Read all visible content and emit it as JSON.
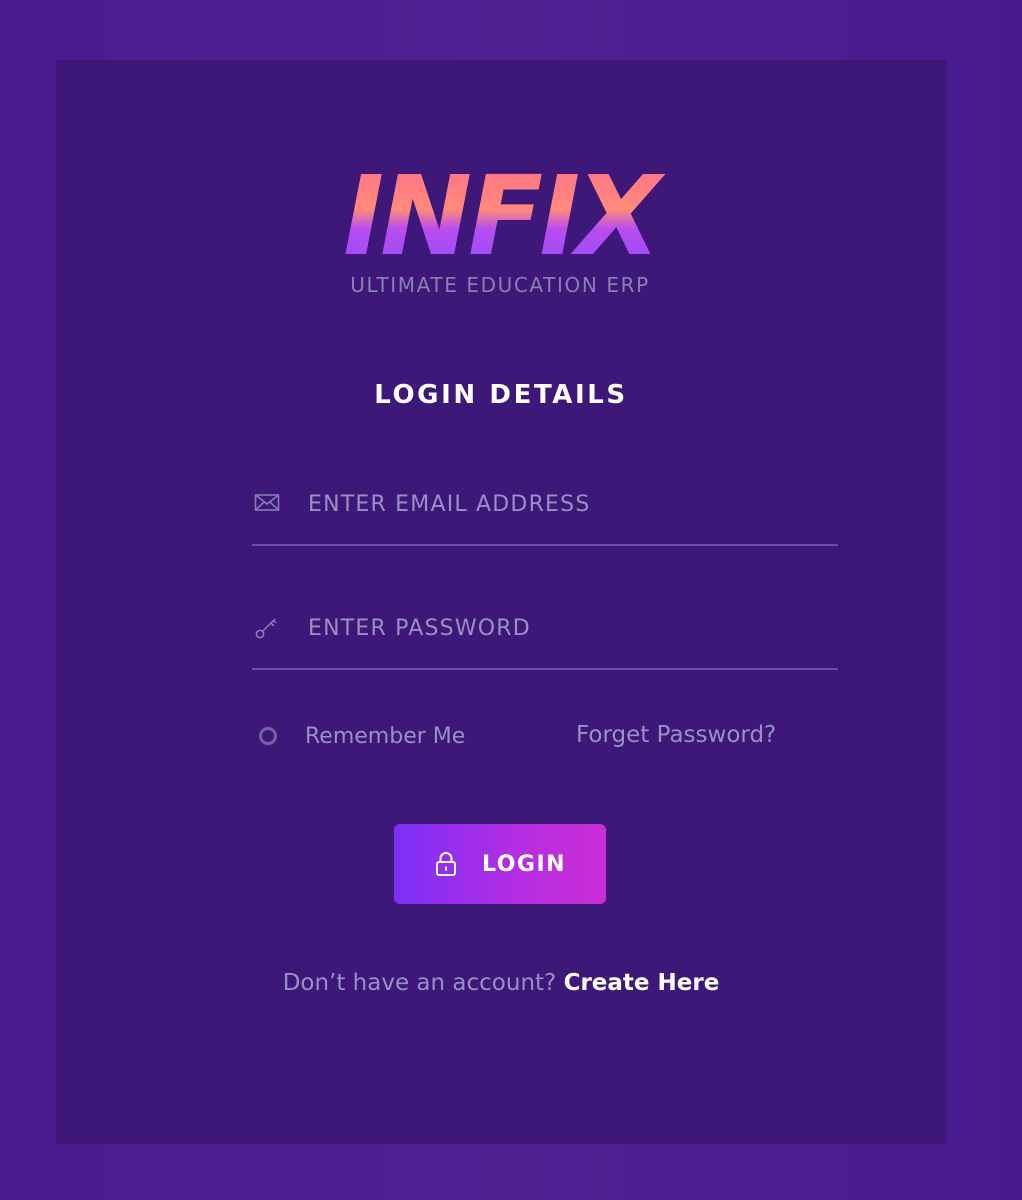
{
  "logo": {
    "name": "INFIX",
    "tagline": "ULTIMATE EDUCATION ERP"
  },
  "form": {
    "title": "LOGIN DETAILS",
    "email": {
      "icon": "envelope-icon",
      "placeholder": "ENTER EMAIL ADDRESS",
      "value": ""
    },
    "password": {
      "icon": "key-icon",
      "placeholder": "ENTER PASSWORD",
      "value": ""
    },
    "remember_label": "Remember Me",
    "remember_checked": false,
    "forgot_label": "Forget Password?",
    "login_button": {
      "icon": "lock-icon",
      "label": "LOGIN"
    },
    "signup_prompt": "Don’t have an account?",
    "signup_link": "Create Here"
  },
  "colors": {
    "background": "#4a1f90",
    "card": "#3e1878",
    "accent_start": "#7b2ff7",
    "accent_end": "#c92ed6",
    "muted_text": "#9a8fc6",
    "logo_pink": "#ff6f91",
    "logo_purple": "#9b4dff"
  }
}
